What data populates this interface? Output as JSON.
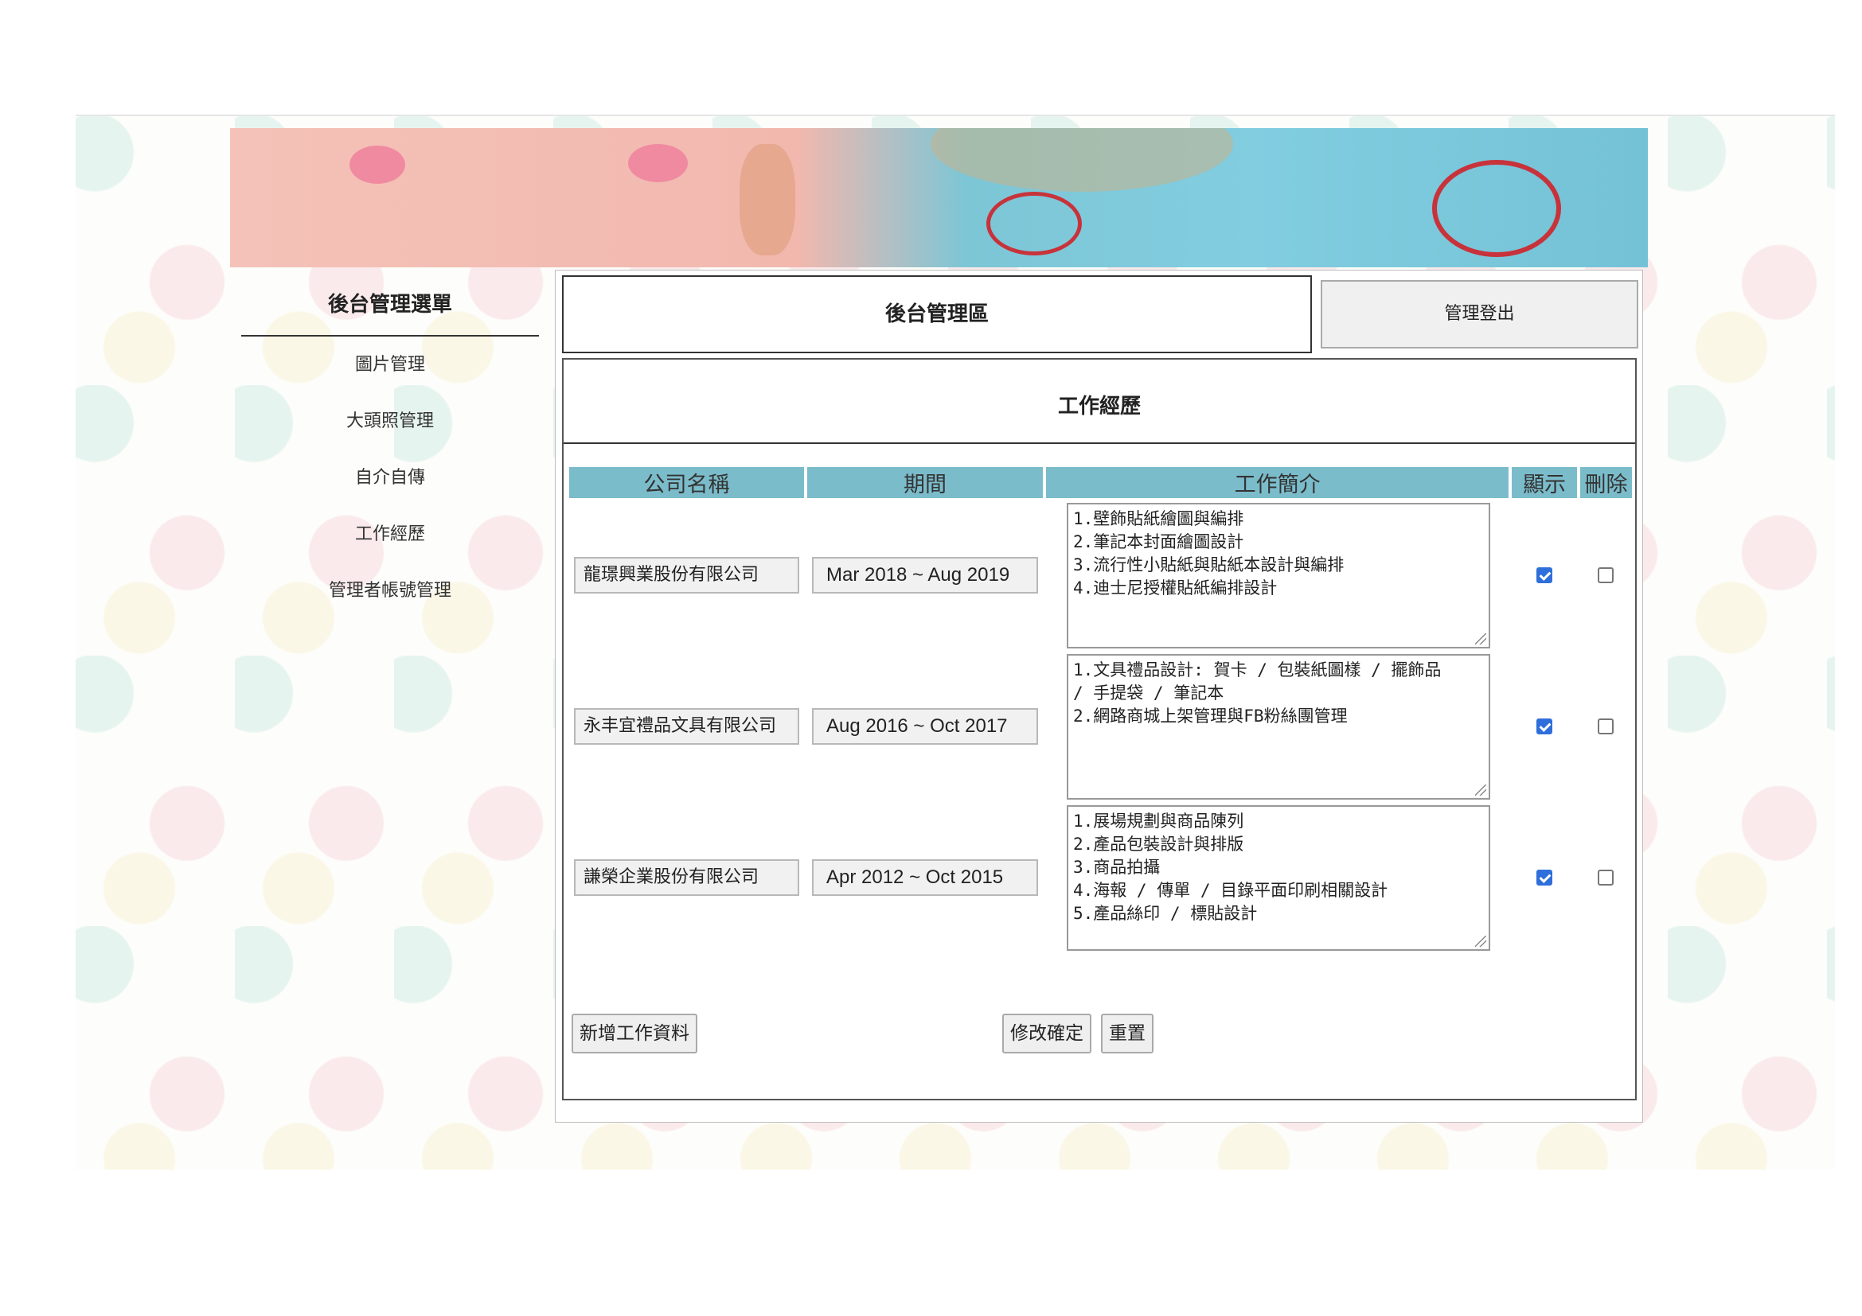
{
  "sidebar": {
    "title": "後台管理選單",
    "items": [
      {
        "label": "圖片管理"
      },
      {
        "label": "大頭照管理"
      },
      {
        "label": "自介自傳"
      },
      {
        "label": "工作經歷"
      },
      {
        "label": "管理者帳號管理"
      }
    ]
  },
  "header": {
    "title": "後台管理區",
    "logout_label": "管理登出"
  },
  "section": {
    "title": "工作經歷"
  },
  "table": {
    "headers": {
      "company": "公司名稱",
      "period": "期間",
      "description": "工作簡介",
      "show": "顯示",
      "delete": "刪除"
    },
    "rows": [
      {
        "company": "龍璟興業股份有限公司",
        "period": "Mar 2018 ~ Aug 2019",
        "description": "1.壁飾貼紙繪圖與編排\n2.筆記本封面繪圖設計\n3.流行性小貼紙與貼紙本設計與編排\n4.迪士尼授權貼紙編排設計",
        "show": true,
        "delete": false
      },
      {
        "company": "永丰宜禮品文具有限公司",
        "period": "Aug 2016 ~ Oct 2017",
        "description": "1.文具禮品設計: 賀卡 / 包裝紙圖樣 / 擺飾品\n/ 手提袋 / 筆記本\n2.網路商城上架管理與FB粉絲團管理",
        "show": true,
        "delete": false
      },
      {
        "company": "謙榮企業股份有限公司",
        "period": "Apr 2012 ~ Oct 2015",
        "description": "1.展場規劃與商品陳列\n2.產品包裝設計與排版\n3.商品拍攝\n4.海報 / 傳單 / 目錄平面印刷相關設計\n5.產品絲印 / 標貼設計",
        "show": true,
        "delete": false
      }
    ]
  },
  "buttons": {
    "add": "新增工作資料",
    "confirm": "修改確定",
    "reset": "重置"
  },
  "colors": {
    "table_header": "#7bbccb",
    "checkbox_checked": "#2f6fdb"
  }
}
